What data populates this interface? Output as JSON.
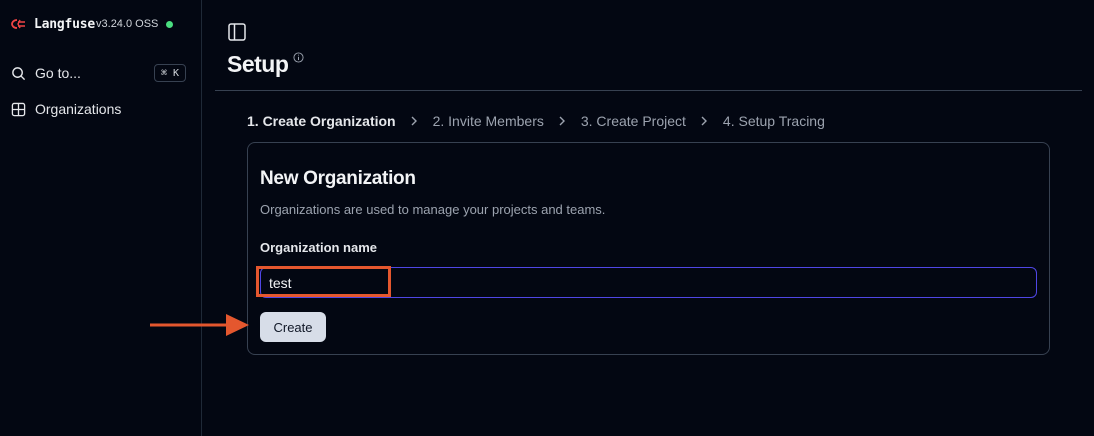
{
  "sidebar": {
    "brand_name": "Langfuse",
    "version": "v3.24.0 OSS",
    "status_color": "#4ade80",
    "items": [
      {
        "label": "Go to...",
        "icon": "search-icon",
        "shortcut": "⌘ K"
      },
      {
        "label": "Organizations",
        "icon": "grid-icon"
      }
    ]
  },
  "header": {
    "title": "Setup",
    "info_icon": "info-icon"
  },
  "steps": [
    {
      "label": "1. Create Organization",
      "active": true
    },
    {
      "label": "2. Invite Members"
    },
    {
      "label": "3. Create Project"
    },
    {
      "label": "4. Setup Tracing"
    }
  ],
  "card": {
    "title": "New Organization",
    "description": "Organizations are used to manage your projects and teams.",
    "field_label": "Organization name",
    "field_value": "test",
    "button_label": "Create"
  },
  "annotation": {
    "color": "#e4572e"
  }
}
